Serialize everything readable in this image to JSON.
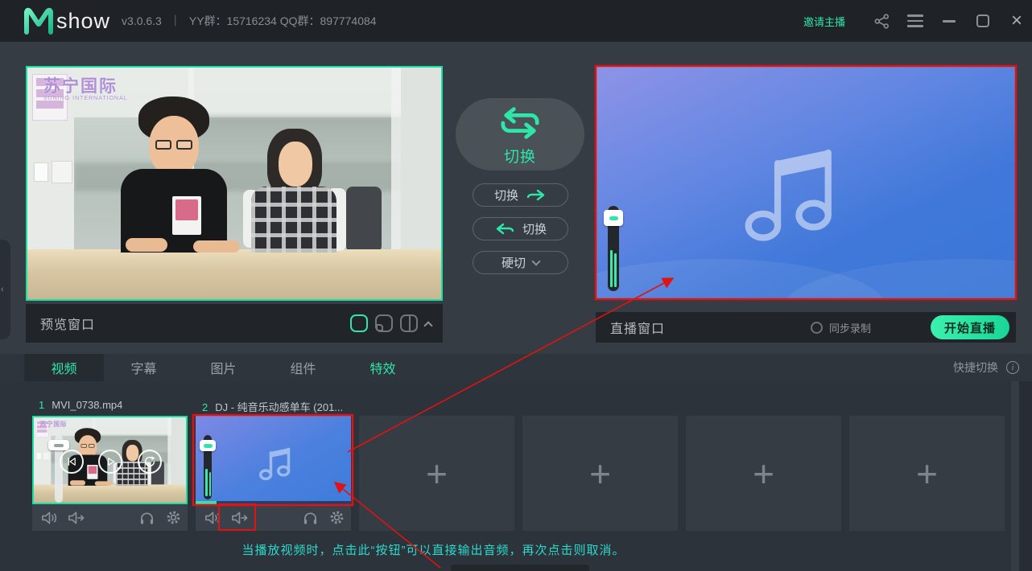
{
  "titlebar": {
    "logo": "M",
    "logo_suffix": "show",
    "version": "v3.0.6.3",
    "separator": "｜",
    "groups": "YY群：15716234 QQ群：897774084",
    "invite_label": "邀请主播"
  },
  "preview": {
    "label": "预览窗口",
    "watermark_title": "苏宁国际",
    "watermark_sub": "SUNING INTERNATIONAL"
  },
  "switcher": {
    "main_label": "切换",
    "forward_label": "切换",
    "backward_label": "切换",
    "mode_label": "硬切"
  },
  "live": {
    "label": "直播窗口",
    "sync_record_label": "同步录制",
    "start_button_label": "开始直播"
  },
  "tabs": [
    {
      "label": "视频"
    },
    {
      "label": "字幕"
    },
    {
      "label": "图片"
    },
    {
      "label": "组件"
    },
    {
      "label": "特效"
    }
  ],
  "quick_switch_label": "快捷切换",
  "media_items": [
    {
      "index": "1",
      "name": "MVI_0738.mp4"
    },
    {
      "index": "2",
      "name": "DJ - 纯音乐动感单车 (201..."
    }
  ],
  "annotation_text": "当播放视频时，点击此“按钮”可以直接输出音频，再次点击则取消。",
  "icons": {
    "add": "+",
    "close": "×",
    "info": "i",
    "collapse": "‹"
  },
  "colors": {
    "accent_green": "#2ee6a8",
    "annotation_red": "#e01212",
    "annotation_cyan": "#2bd9cd",
    "title_bar": "#1f2327",
    "live_gradient_start": "#8e93e6",
    "live_gradient_end": "#3a76d6",
    "start_button_green": "#25e3a2"
  }
}
